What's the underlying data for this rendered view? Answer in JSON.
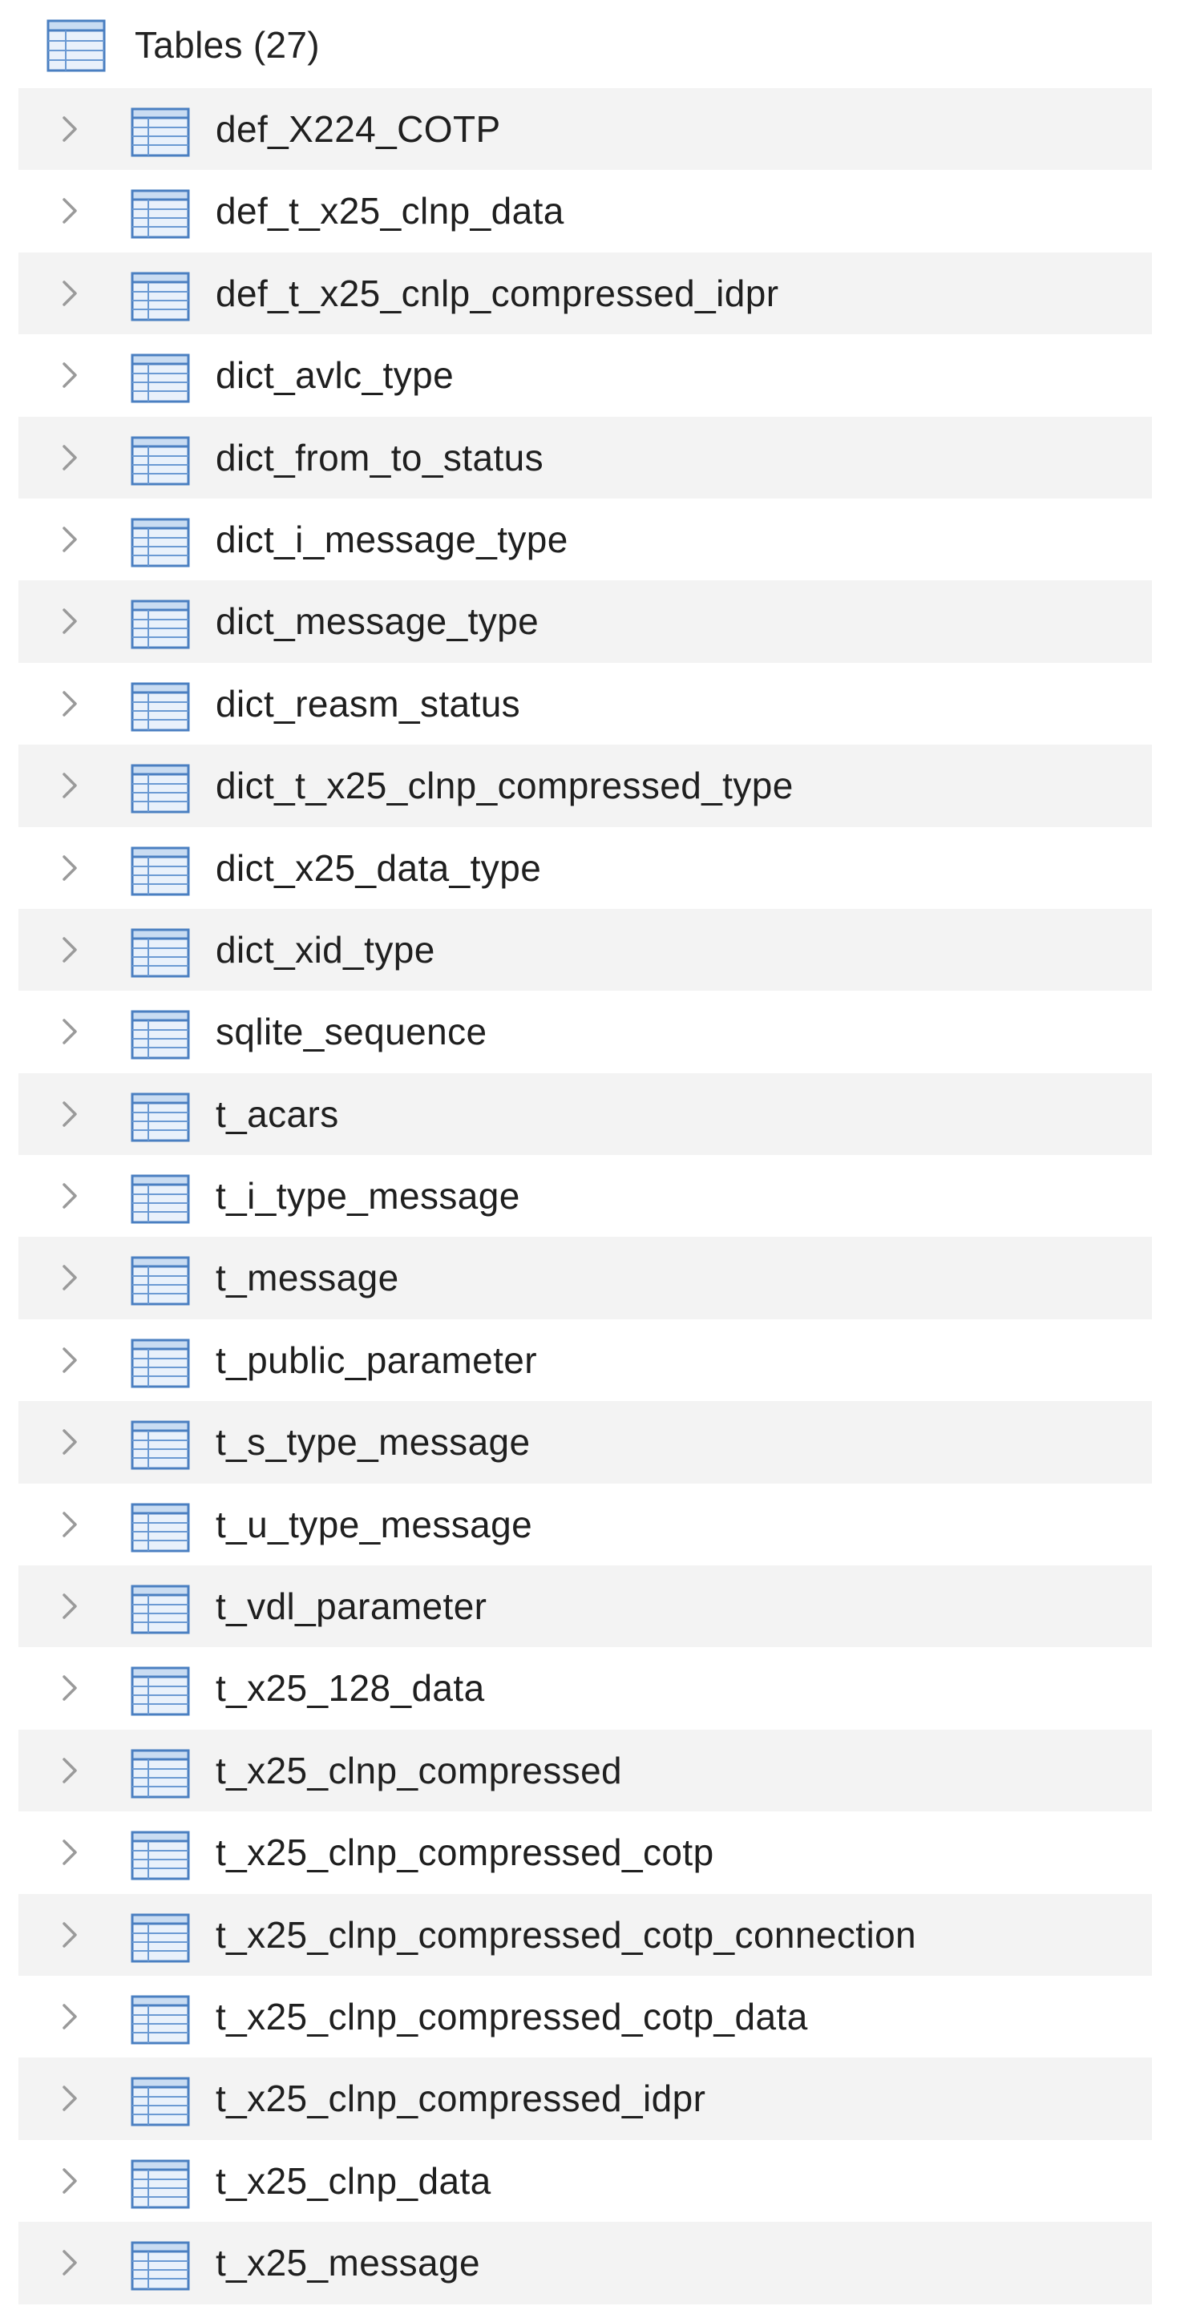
{
  "group": {
    "label": "Tables (27)",
    "icon": "table-icon"
  },
  "colors": {
    "stripe": "#f3f3f3",
    "icon_blue": "#4a7fc1",
    "chevron": "#9a9a9a"
  },
  "tables": [
    "def_X224_COTP",
    "def_t_x25_clnp_data",
    "def_t_x25_cnlp_compressed_idpr",
    "dict_avlc_type",
    "dict_from_to_status",
    "dict_i_message_type",
    "dict_message_type",
    "dict_reasm_status",
    "dict_t_x25_clnp_compressed_type",
    "dict_x25_data_type",
    "dict_xid_type",
    "sqlite_sequence",
    "t_acars",
    "t_i_type_message",
    "t_message",
    "t_public_parameter",
    "t_s_type_message",
    "t_u_type_message",
    "t_vdl_parameter",
    "t_x25_128_data",
    "t_x25_clnp_compressed",
    "t_x25_clnp_compressed_cotp",
    "t_x25_clnp_compressed_cotp_connection",
    "t_x25_clnp_compressed_cotp_data",
    "t_x25_clnp_compressed_idpr",
    "t_x25_clnp_data",
    "t_x25_message"
  ]
}
